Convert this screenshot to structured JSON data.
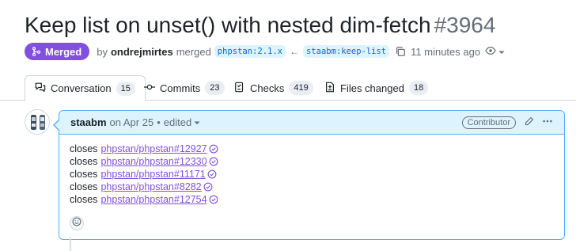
{
  "pr": {
    "title": "Keep list on unset() with nested dim-fetch",
    "number": "#3964",
    "state": "Merged",
    "merged_by_prefix": "by",
    "merged_by": "ondrejmirtes",
    "base_branch": "phpstan:2.1.x",
    "head_branch": "staabm:keep-list",
    "time_ago": "11 minutes ago"
  },
  "tabs": [
    {
      "label": "Conversation",
      "count": "15"
    },
    {
      "label": "Commits",
      "count": "23"
    },
    {
      "label": "Checks",
      "count": "419"
    },
    {
      "label": "Files changed",
      "count": "18"
    }
  ],
  "comment": {
    "author": "staabm",
    "date": "on Apr 25",
    "separator": "•",
    "edited": "edited",
    "role": "Contributor",
    "lines": [
      {
        "prefix": "closes",
        "link": "phpstan/phpstan#12927"
      },
      {
        "prefix": "closes",
        "link": "phpstan/phpstan#12330"
      },
      {
        "prefix": "closes",
        "link": "phpstan/phpstan#11171"
      },
      {
        "prefix": "closes",
        "link": "phpstan/phpstan#8282"
      },
      {
        "prefix": "closes",
        "link": "phpstan/phpstan#12754"
      }
    ]
  },
  "icons": {
    "merged": "git-merge-icon",
    "copy": "copy-icon",
    "watch": "eye-icon",
    "edit": "pencil-icon",
    "more": "kebab-horizontal-icon",
    "reaction": "smiley-icon",
    "issue_closed": "check-circle-icon"
  },
  "colors": {
    "merged": "#8250df",
    "link": "#8250df",
    "branch_bg": "#ddf4ff",
    "branch_fg": "#0969da",
    "comment_border": "#54aeff",
    "comment_header_bg": "#ddf4ff"
  }
}
